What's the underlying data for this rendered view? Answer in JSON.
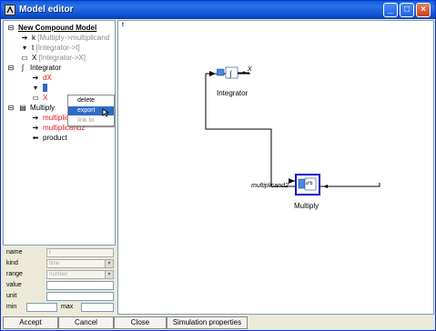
{
  "window": {
    "title": "Model editor"
  },
  "tree": {
    "root": "New Compound Model",
    "items": [
      {
        "name": "k",
        "detail": "[Multiply->multiplicand",
        "icon": "arrow-right"
      },
      {
        "name": "t",
        "detail": "[Integrator->t]",
        "icon": "t-input"
      },
      {
        "name": "X",
        "detail": "[Integrator->X]",
        "icon": "monitor"
      }
    ],
    "integrator": {
      "label": "Integrator",
      "children": [
        {
          "name": "dX",
          "color": "red"
        },
        {
          "name": "",
          "color": "blue"
        },
        {
          "name": "X",
          "color": "red"
        }
      ]
    },
    "multiply": {
      "label": "Multiply",
      "children": [
        {
          "name": "multiplicand1",
          "color": "red"
        },
        {
          "name": "multiplicand2",
          "color": "red"
        },
        {
          "name": "product",
          "color": "black"
        }
      ]
    }
  },
  "context_menu": {
    "items": [
      "delete",
      "export",
      "link to"
    ]
  },
  "properties": {
    "name_label": "name",
    "name_value": "t",
    "kind_label": "kind",
    "kind_value": "time",
    "range_label": "range",
    "range_value": "number",
    "value_label": "value",
    "unit_label": "unit",
    "min_label": "min",
    "max_label": "max"
  },
  "canvas": {
    "corner_mark": "t",
    "integrator_label": "Integrator",
    "integrator_output": "X",
    "multiply_label": "Multiply",
    "multiply_input": "multiplicand2",
    "multiply_symbol": "a*b"
  },
  "footer": {
    "accept": "Accept",
    "cancel": "Cancel",
    "close": "Close",
    "sim_props": "Simulation properties"
  }
}
